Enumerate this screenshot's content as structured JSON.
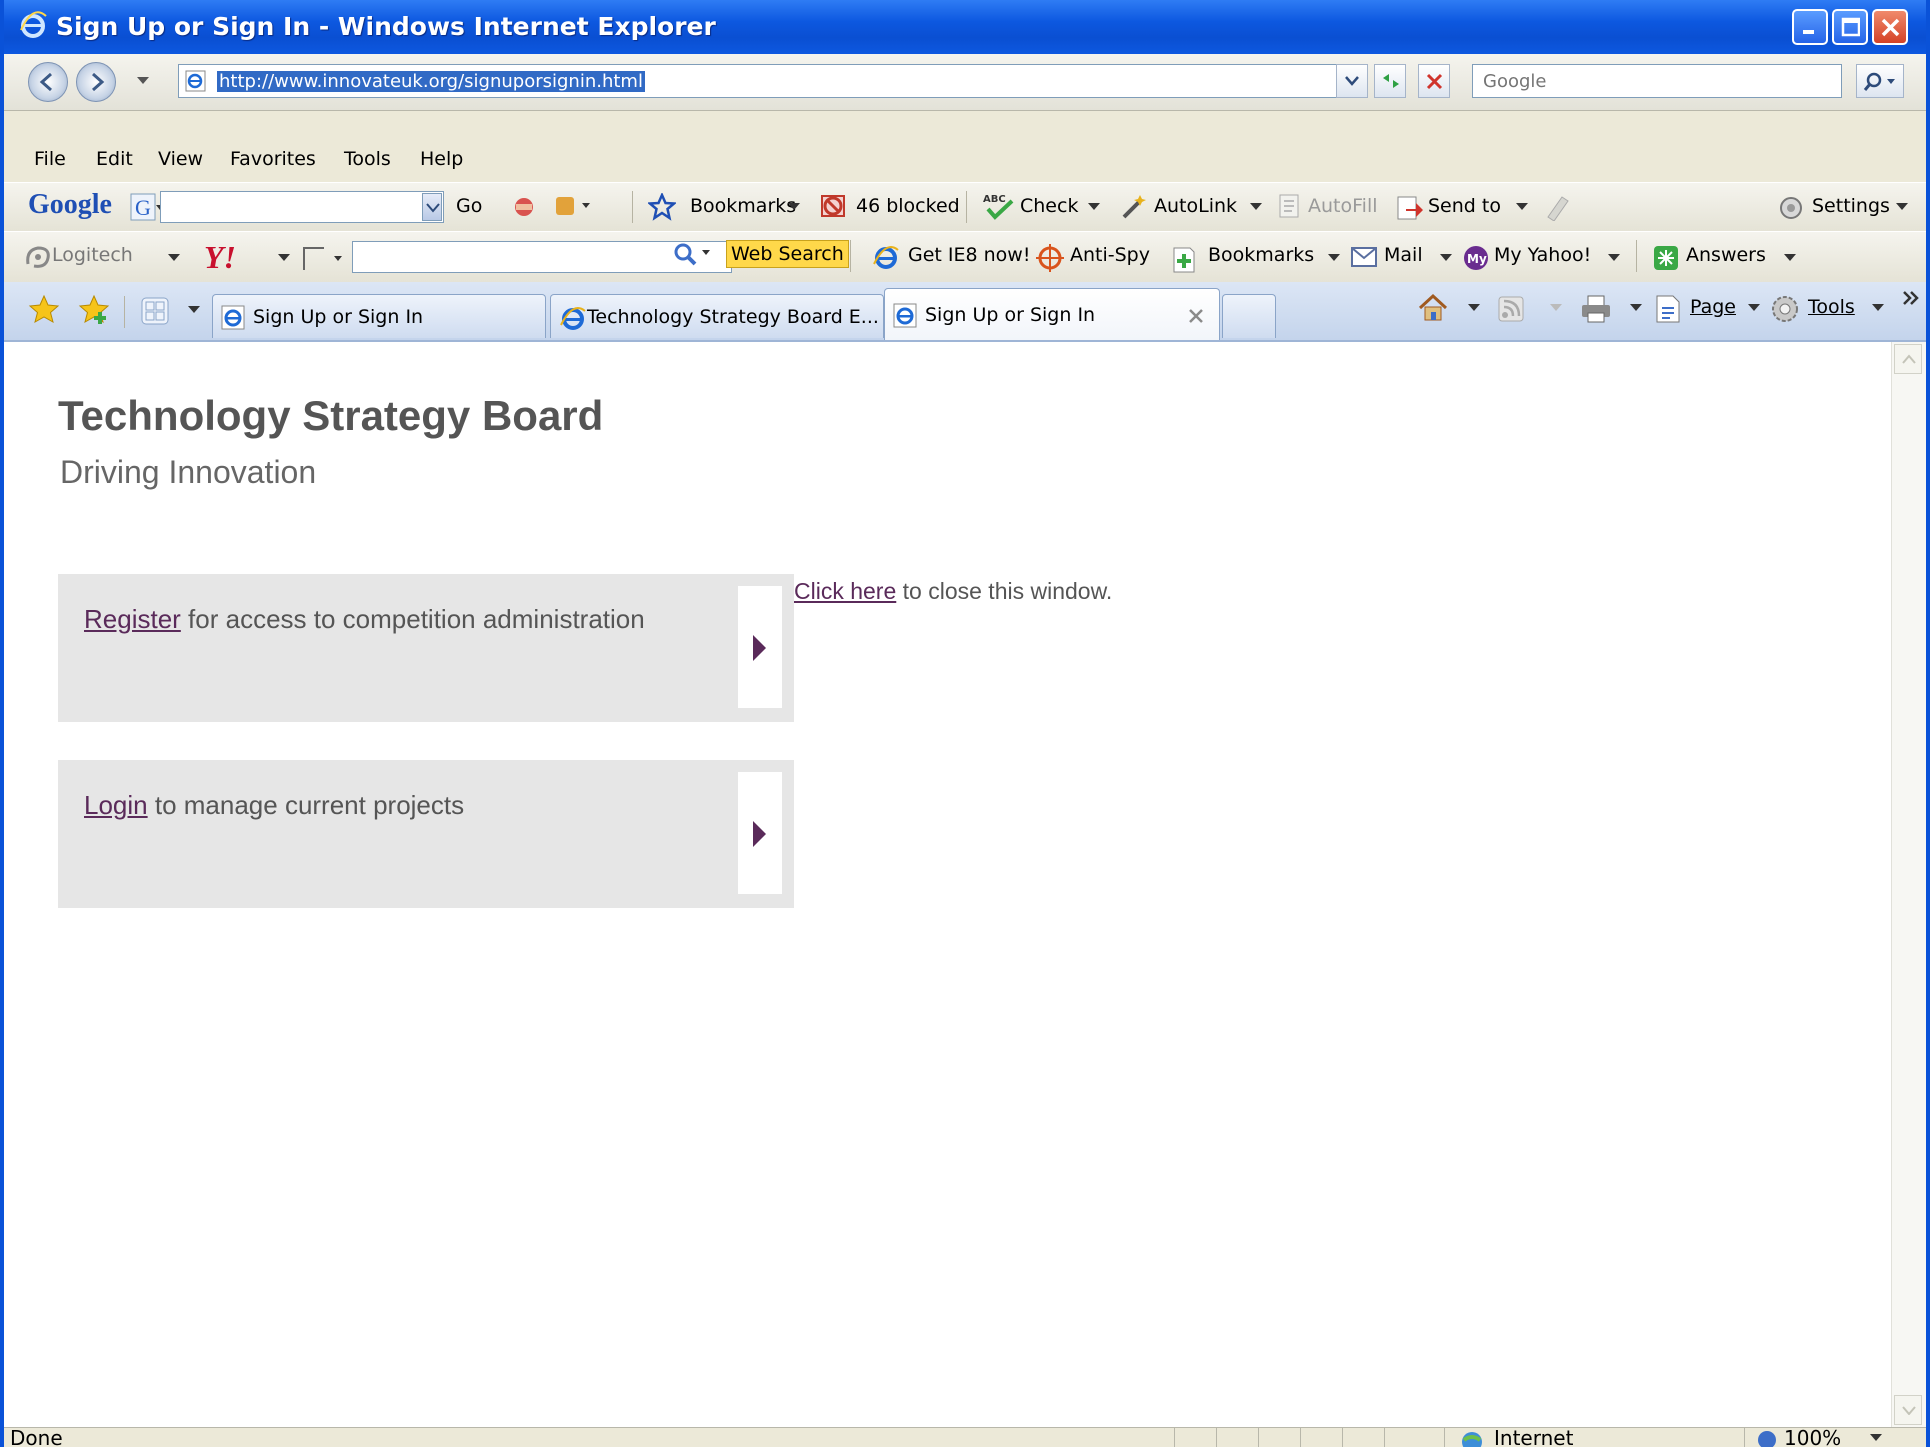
{
  "window": {
    "title": "Sign Up or Sign In - Windows Internet Explorer"
  },
  "address": {
    "url": "http://www.innovateuk.org/signuporsignin.html",
    "search_placeholder": "Google"
  },
  "menu": [
    "File",
    "Edit",
    "View",
    "Favorites",
    "Tools",
    "Help"
  ],
  "google_toolbar": {
    "logo": "Google",
    "go": "Go",
    "bookmarks": "Bookmarks",
    "blocked": "46 blocked",
    "check": "Check",
    "autolink": "AutoLink",
    "autofill": "AutoFill",
    "sendto": "Send to",
    "settings": "Settings"
  },
  "yahoo_toolbar": {
    "logitech": "Logitech",
    "web_search": "Web Search",
    "get_ie8": "Get IE8 now!",
    "anti_spy": "Anti-Spy",
    "bookmarks": "Bookmarks",
    "mail": "Mail",
    "my_yahoo": "My Yahoo!",
    "answers": "Answers"
  },
  "tabs": [
    {
      "label": "Sign Up or Sign In"
    },
    {
      "label": "Technology Strategy Board E..."
    },
    {
      "label": "Sign Up or Sign In"
    }
  ],
  "command_bar": {
    "page": "Page",
    "tools": "Tools"
  },
  "page": {
    "title": "Technology Strategy Board",
    "subtitle": "Driving Innovation",
    "register_link": "Register",
    "register_text": " for access to competition administration",
    "login_link": "Login",
    "login_text": " to manage current projects",
    "close_link": "Click here",
    "close_text": " to close this window."
  },
  "status": {
    "text": "Done",
    "zone": "Internet",
    "zoom": "100%"
  },
  "colors": {
    "title_bar": "#0a52d8",
    "link": "#5a2a5a",
    "card_bg": "#e6e6e6"
  }
}
